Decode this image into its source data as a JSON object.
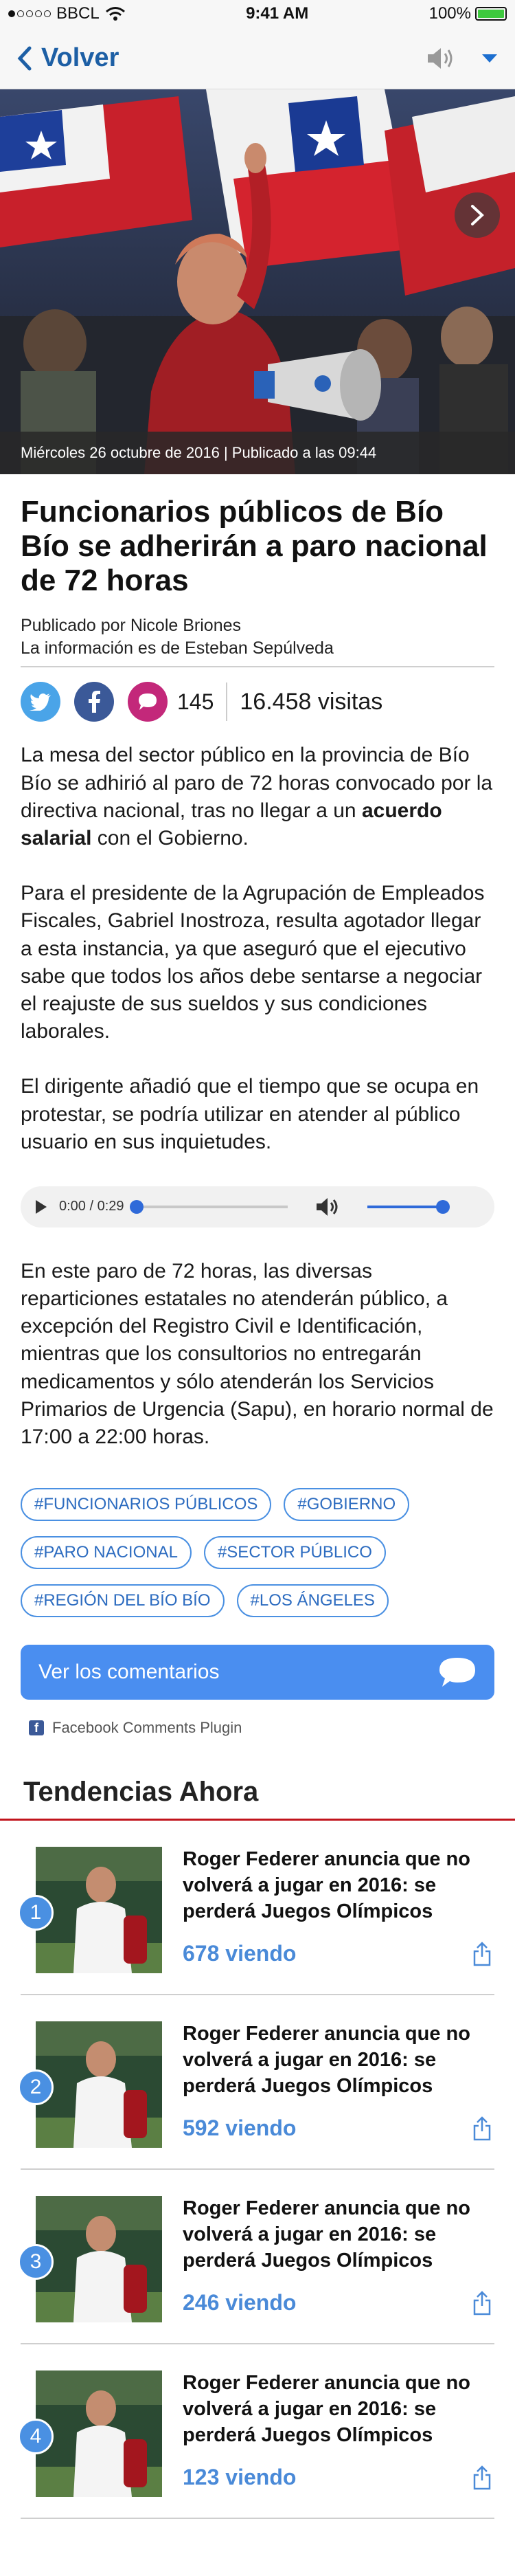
{
  "status_bar": {
    "carrier": "BBCL",
    "time": "9:41 AM",
    "battery": "100%",
    "battery_level": 1.0
  },
  "nav": {
    "back_label": "Volver"
  },
  "hero": {
    "caption": "Miércoles 26 octubre de 2016 | Publicado a las 09:44"
  },
  "article": {
    "headline": "Funcionarios públicos de Bío Bío se adherirán a paro nacional de 72 horas",
    "published_by": "Publicado por Nicole Briones",
    "info_by": "La información es de Esteban Sepúlveda",
    "comment_count": "145",
    "visits": "16.458 visitas",
    "p1_before": "La mesa del sector público en la provincia de Bío Bío se adhirió al paro de 72 horas convocado por la directiva nacional, tras no llegar a un ",
    "p1_bold": "acuerdo salarial",
    "p1_after": " con el Gobierno.",
    "p2": "Para el presidente de la Agrupación de Empleados Fiscales, Gabriel Inostroza, resulta agotador llegar a esta instancia, ya que aseguró que el ejecutivo sabe que todos los años debe sentarse a negociar el reajuste de sus sueldos y sus condiciones laborales.",
    "p3": "El dirigente añadió que el tiempo que se ocupa en protestar, se podría utilizar en atender al público usuario en sus inquietudes.",
    "p4": "En este paro de 72 horas, las diversas reparticiones estatales no atenderán público, a excepción del Registro Civil e Identificación, mientras que los consultorios no entregarán medicamentos y sólo atenderán los Servicios Primarios de Urgencia (Sapu), en horario normal de 17:00 a 22:00 horas."
  },
  "audio": {
    "time": "0:00 / 0:29",
    "progress": 0.0,
    "volume": 1.0
  },
  "tags": [
    "#FUNCIONARIOS PÚBLICOS",
    "#GOBIERNO",
    "#PARO NACIONAL",
    "#SECTOR PÚBLICO",
    "#REGIÓN DEL BÍO BÍO",
    "#LOS ÁNGELES"
  ],
  "comments": {
    "button_label": "Ver los comentarios",
    "plugin_label": "Facebook Comments Plugin",
    "fb_letter": "f"
  },
  "trends": {
    "title": "Tendencias Ahora",
    "items": [
      {
        "rank": "1",
        "headline": "Roger Federer anuncia que no volverá a jugar en 2016: se perderá Juegos Olímpicos",
        "views": "678 viendo"
      },
      {
        "rank": "2",
        "headline": "Roger Federer anuncia que no volverá a jugar en 2016: se perderá Juegos Olímpicos",
        "views": "592 viendo"
      },
      {
        "rank": "3",
        "headline": "Roger Federer anuncia que no volverá a jugar en 2016: se perderá Juegos Olímpicos",
        "views": "246 viendo"
      },
      {
        "rank": "4",
        "headline": "Roger Federer anuncia que no volverá a jugar en 2016: se perderá Juegos Olímpicos",
        "views": "123 viendo"
      }
    ]
  },
  "colors": {
    "accent_blue": "#1d5fa5",
    "link_blue": "#4a8ad8",
    "trend_red": "#c1141c",
    "twitter": "#4aa4e8",
    "facebook": "#3b5998",
    "comment_pink": "#c3287a"
  },
  "icons": [
    "signal-dots-icon",
    "wifi-icon",
    "battery-icon",
    "back-chevron-icon",
    "speaker-icon",
    "dropdown-icon",
    "next-arrow-icon",
    "twitter-icon",
    "facebook-icon",
    "comment-icon",
    "play-icon",
    "volume-icon",
    "chat-bubble-icon",
    "share-icon"
  ]
}
